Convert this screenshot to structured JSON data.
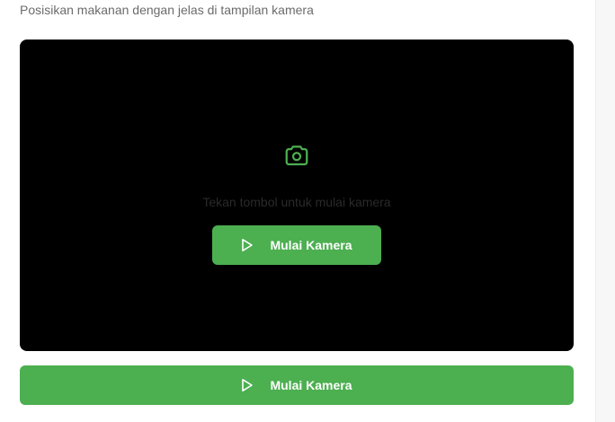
{
  "header": {
    "subtitle": "Posisikan makanan dengan jelas di tampilan kamera"
  },
  "camera": {
    "hint": "Tekan tombol untuk mulai kamera",
    "icon": "camera-icon",
    "start_button_label": "Mulai Kamera"
  },
  "actions": {
    "start_button_label": "Mulai Kamera",
    "icon": "play-icon"
  },
  "colors": {
    "accent": "#4caf50",
    "camera_background": "#000000",
    "hint_text": "#2a2a2a",
    "subtitle_text": "#6b6b6b"
  }
}
